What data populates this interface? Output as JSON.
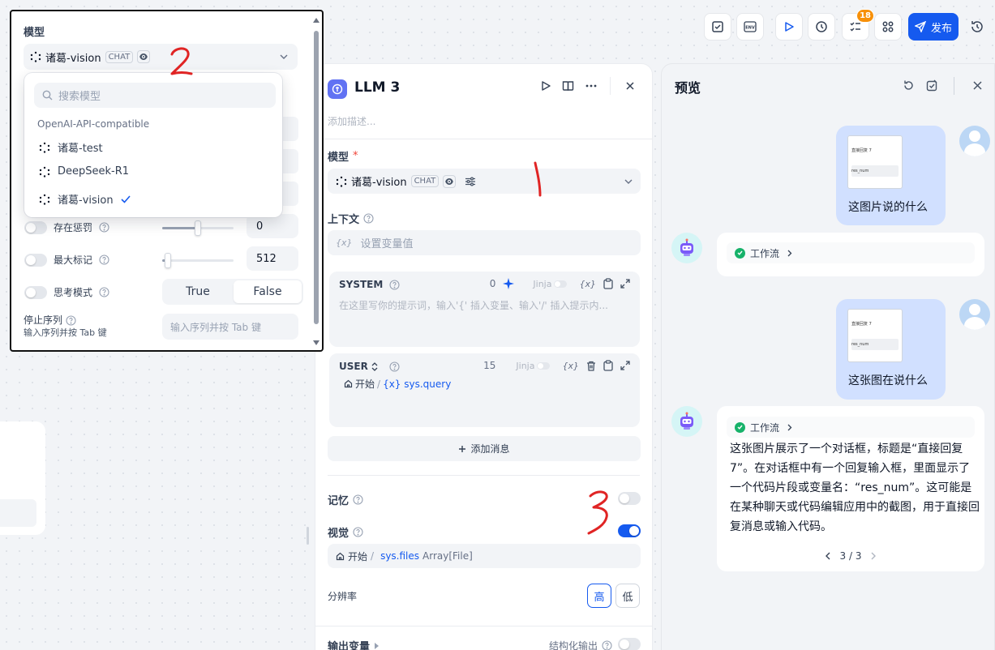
{
  "toolbar": {
    "publish_label": "发布",
    "badge_count": "18",
    "icons": [
      "checklist-icon",
      "env-icon",
      "run-icon",
      "history-clock-icon",
      "checklist-badge-icon",
      "apps-icon",
      "publish-send-icon",
      "history-icon"
    ]
  },
  "llm_panel": {
    "title": "LLM 3",
    "description_placeholder": "添加描述...",
    "model_label": "模型",
    "required_mark": "*",
    "model_name": "诸葛-vision",
    "model_tag": "CHAT",
    "context_label": "上下文",
    "context_placeholder": "设置变量值",
    "var_symbol": "{x}",
    "system": {
      "label": "SYSTEM",
      "count": "0",
      "jinja": "Jinja",
      "var_symbol": "{x}",
      "placeholder": "在这里写你的提示词，输入'{' 插入变量、输入'/' 插入提示内..."
    },
    "user": {
      "label": "USER",
      "count": "15",
      "jinja": "Jinja",
      "var_symbol": "{x}",
      "start_node": "开始",
      "separator": "/",
      "var_text": "{x} sys.query"
    },
    "add_message": "添加消息",
    "memory_label": "记忆",
    "memory_on": false,
    "vision_label": "视觉",
    "vision_on": true,
    "vision_var": {
      "start_node": "开始",
      "separator": "/",
      "var": "sys.files",
      "type": "Array[File]"
    },
    "resolution_label": "分辨率",
    "resolution_high": "高",
    "resolution_low": "低",
    "output_label": "输出变量",
    "structured_label": "结构化输出"
  },
  "preview": {
    "title": "预览",
    "messages": [
      {
        "role": "user",
        "text": "这图片说的什么",
        "thumb_title": "直接回复 7",
        "thumb_var": "res_num"
      },
      {
        "role": "bot",
        "workflow": "工作流"
      },
      {
        "role": "user",
        "text": "这张图在说什么",
        "thumb_title": "直接回复 7",
        "thumb_var": "res_num"
      },
      {
        "role": "bot",
        "workflow": "工作流",
        "answer": "这张图片展示了一个对话框，标题是“直接回复7”。在对话框中有一个回复输入框，里面显示了一个代码片段或变量名：“res_num”。这可能是在某种聊天或代码编辑应用中的截图，用于直接回复消息或输入代码。",
        "pager": "3 / 3"
      }
    ]
  },
  "popup": {
    "model_label": "模型",
    "model_name": "诸葛-vision",
    "model_tag": "CHAT",
    "params": [
      {
        "label": "存在惩罚",
        "value": "0",
        "slider": 0.5
      },
      {
        "label": "最大标记",
        "value": "512",
        "slider": 0.08
      }
    ],
    "thinking_label": "思考模式",
    "true_label": "True",
    "false_label": "False",
    "stop_label": "停止序列",
    "stop_hint": "输入序列并按 Tab 键",
    "stop_placeholder": "输入序列并按 Tab 键"
  },
  "dropdown": {
    "search_placeholder": "搜索模型",
    "group_label": "OpenAI-API-compatible",
    "items": [
      {
        "label": "诸葛-test",
        "selected": false
      },
      {
        "label": "DeepSeek-R1",
        "selected": false
      },
      {
        "label": "诸葛-vision",
        "selected": true
      }
    ]
  },
  "annotations": {
    "model_select_mark": "1",
    "dropdown_mark": "2",
    "vision_mark": "3",
    "color": "#e02424"
  }
}
